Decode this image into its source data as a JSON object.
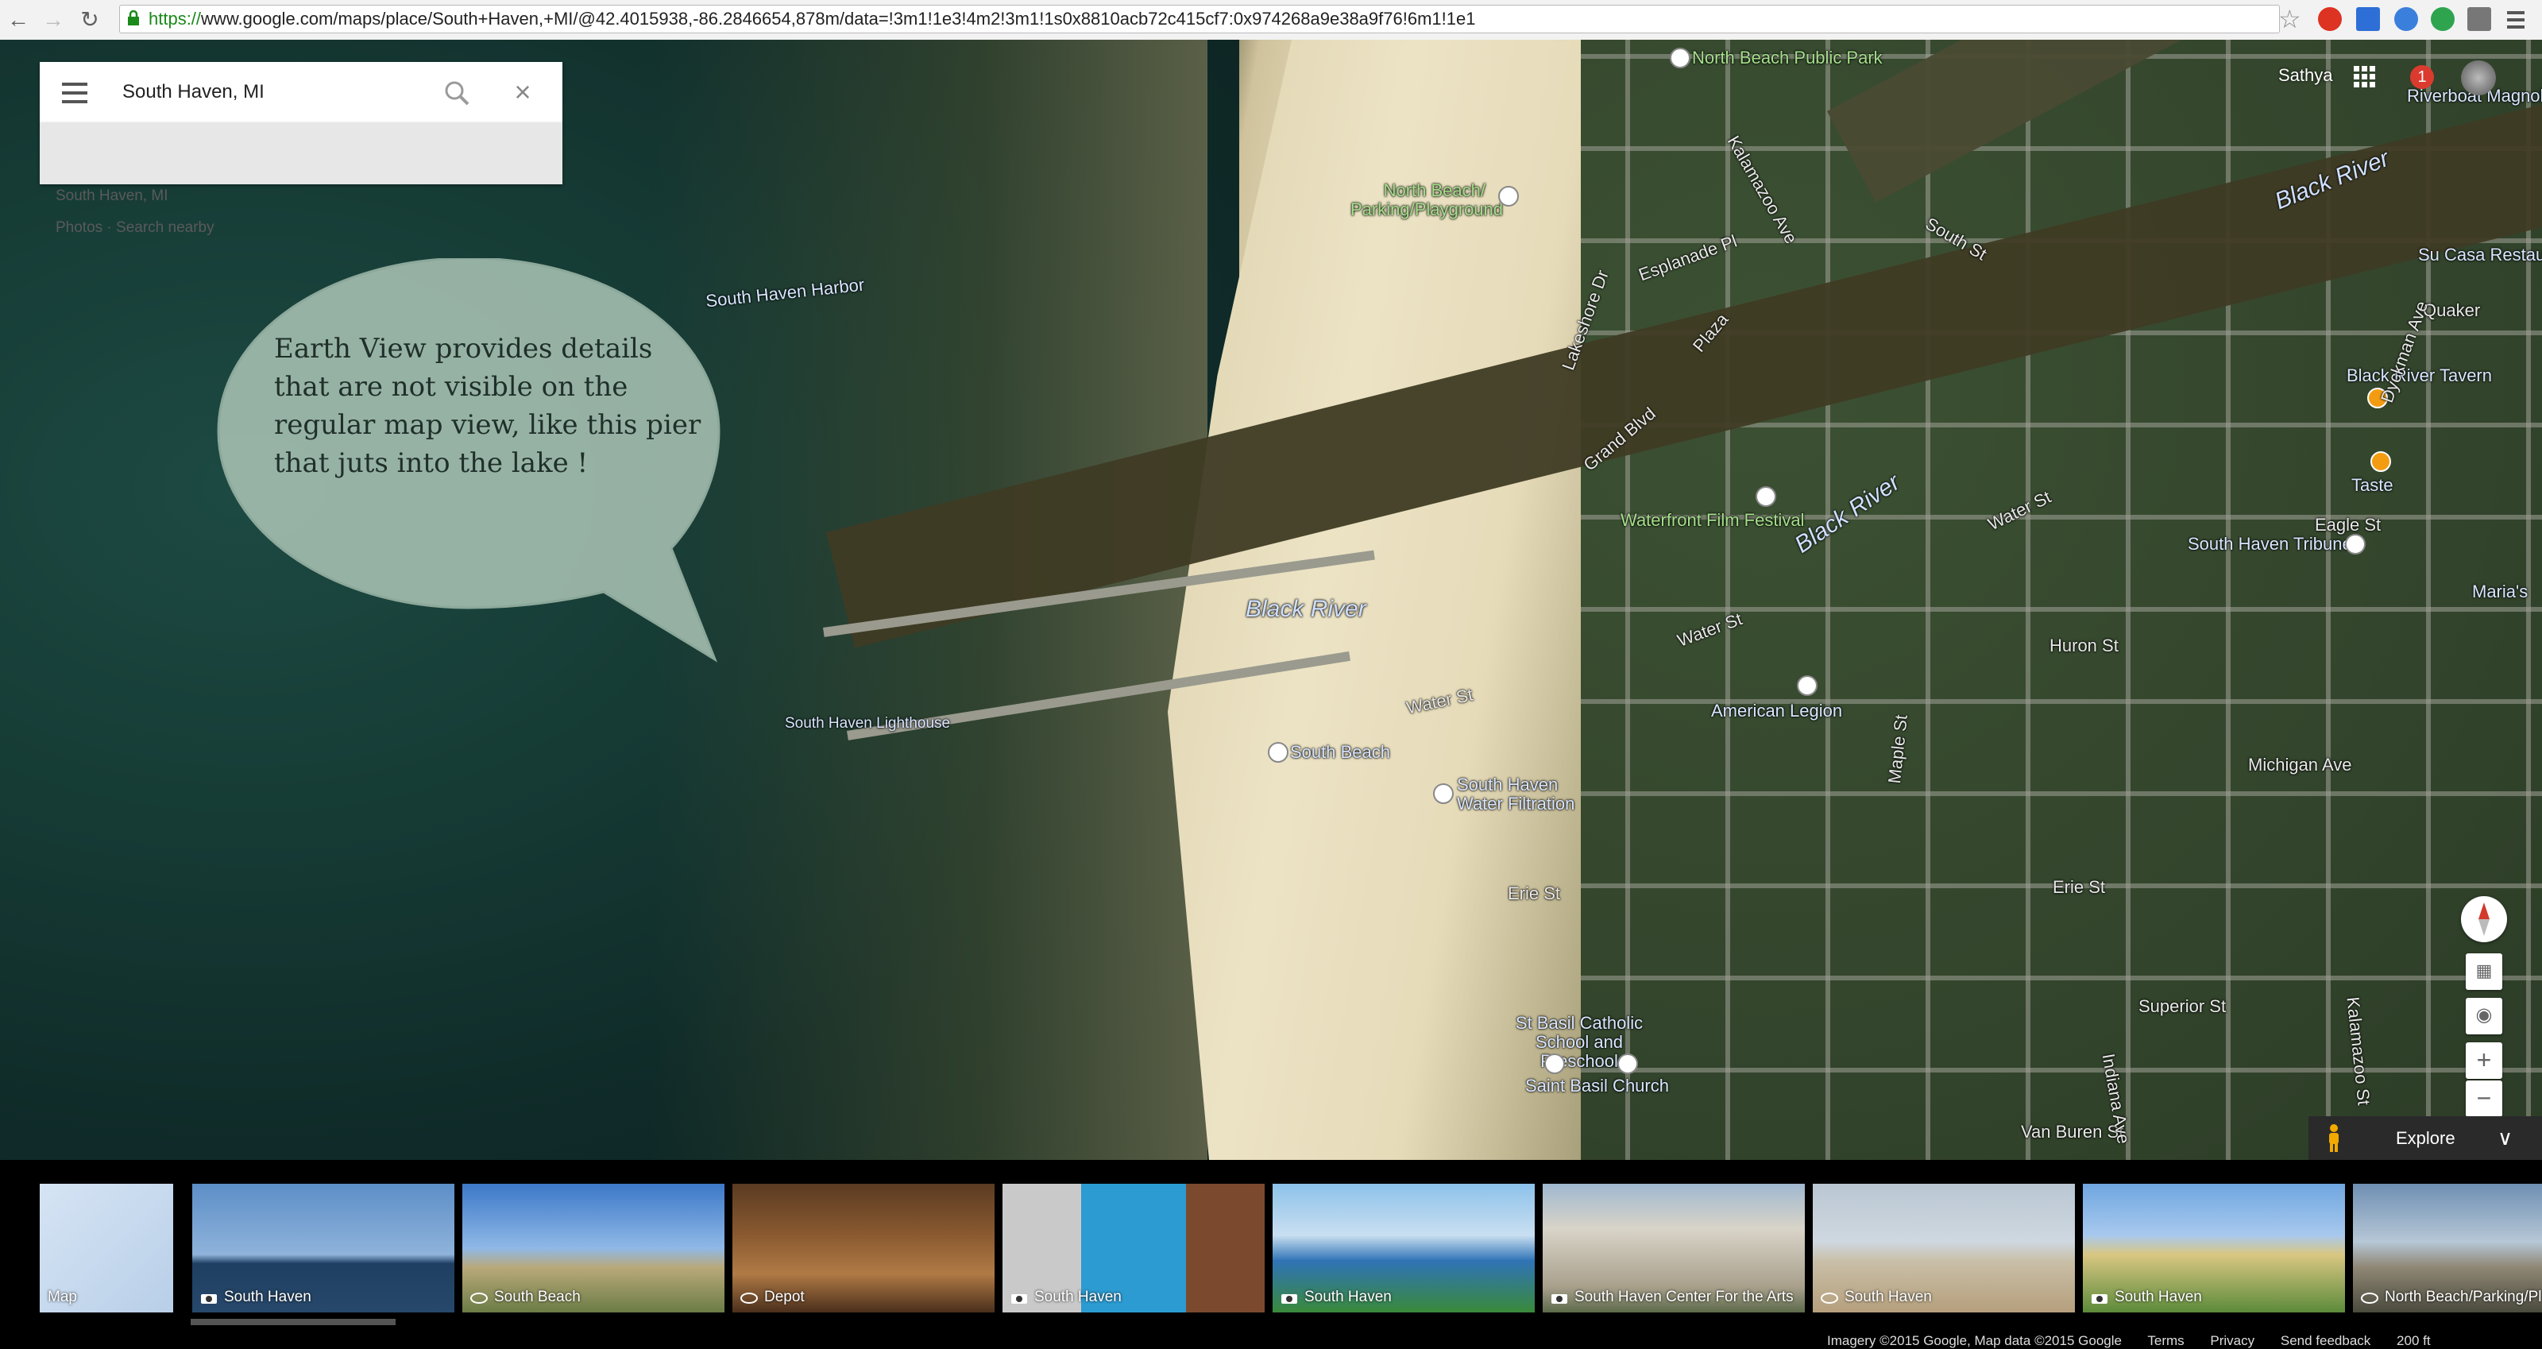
{
  "browser": {
    "url_proto": "https://",
    "url_rest": "www.google.com/maps/place/South+Haven,+MI/@42.4015938,-86.2846654,878m/data=!3m1!1e3!4m2!3m1!1s0x8810acb72c415cf7:0x974268a9e38a9f76!6m1!1e1"
  },
  "search": {
    "query": "South Haven, MI",
    "suggestions": [
      "South Haven, MI",
      "Photos · Search nearby"
    ]
  },
  "callout": {
    "text": "Earth View provides details that are not visible on the regular map view, like this pier that juts into the lake !"
  },
  "account": {
    "name": "Sathya",
    "notifications": "1"
  },
  "map_labels": {
    "harbor": "South Haven Harbor",
    "north_beach_park": "North Beach Public Park",
    "north_beach_playground": "North Beach/ Parking/Playground",
    "black_river_main": "Black River",
    "black_river_mid": "Black River",
    "black_river_top": "Black River",
    "lighthouse": "South Haven Lighthouse",
    "south_beach": "South Beach",
    "water_filtration": "South Haven Water Filtration",
    "water_st_1": "Water St",
    "water_st_2": "Water St",
    "water_st_3": "Water St",
    "waterfront_film": "Waterfront Film Festival",
    "american_legion": "American Legion",
    "huron_st": "Huron St",
    "michigan_ave": "Michigan Ave",
    "erie_st_1": "Erie St",
    "erie_st_2": "Erie St",
    "superior_st": "Superior St",
    "van_buren_st": "Van Buren St",
    "st_basil": "St Basil Catholic School and Preschool",
    "saint_basil_church": "Saint Basil Church",
    "eagle_st": "Eagle St",
    "sh_tribune": "South Haven Tribune",
    "marias": "Maria's",
    "taste": "Taste",
    "black_river_tavern": "Black River Tavern",
    "su_casa": "Su Casa Restaurant",
    "riverboat": "Riverboat Magnolia",
    "maple_st": "Maple St",
    "kalamazoo_st": "Kalamazoo St",
    "indiana_ave": "Indiana Ave",
    "south_st": "South St",
    "grand_blvd": "Grand Blvd",
    "plaza": "Plaza",
    "esplanade_pl": "Esplanade Pl",
    "kalamazoo_ave": "Kalamazoo Ave",
    "lakeshore": "Lakeshore Dr",
    "quaker": "Quaker",
    "dyckman": "Dyckman Ave"
  },
  "controls": {
    "explore": "Explore"
  },
  "photos": [
    {
      "caption": "Map",
      "kind": "map"
    },
    {
      "caption": "South Haven",
      "kind": "camera"
    },
    {
      "caption": "South Beach",
      "kind": "360"
    },
    {
      "caption": "Depot",
      "kind": "360"
    },
    {
      "caption": "South Haven",
      "kind": "camera"
    },
    {
      "caption": "South Haven",
      "kind": "camera"
    },
    {
      "caption": "South Haven Center For the Arts",
      "kind": "camera"
    },
    {
      "caption": "South Haven",
      "kind": "360"
    },
    {
      "caption": "South Haven",
      "kind": "camera"
    },
    {
      "caption": "North Beach/Parking/Pl",
      "kind": "360"
    }
  ],
  "footer": {
    "imagery": "Imagery ©2015 Google, Map data ©2015 Google",
    "terms": "Terms",
    "privacy": "Privacy",
    "feedback": "Send feedback",
    "scale": "200 ft"
  },
  "colors": {
    "accent_red": "#db3b2f",
    "lake": "#163b35",
    "sand": "#e9dfbe"
  }
}
